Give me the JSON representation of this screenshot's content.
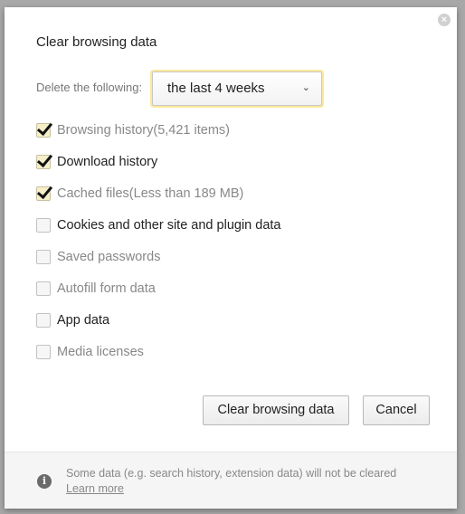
{
  "dialog": {
    "title": "Clear browsing data",
    "close_icon": "close-circle-icon",
    "delete_label": "Delete the following:",
    "time_range": "the last 4 weeks",
    "options": [
      {
        "label": "Browsing history",
        "detail": " (5,421 items)",
        "checked": true
      },
      {
        "label": "Download history",
        "detail": "",
        "checked": true
      },
      {
        "label": "Cached files",
        "detail": " (Less than 189 MB)",
        "checked": true
      },
      {
        "label": "Cookies and other site and plugin data",
        "detail": "",
        "checked": false
      },
      {
        "label": "Saved passwords",
        "detail": "",
        "checked": false
      },
      {
        "label": "Autofill form data",
        "detail": "",
        "checked": false
      },
      {
        "label": "App data",
        "detail": "",
        "checked": false
      },
      {
        "label": "Media licenses",
        "detail": "",
        "checked": false
      }
    ],
    "clear_button": "Clear browsing data",
    "cancel_button": "Cancel",
    "footer": {
      "info_icon": "info-icon",
      "text": "Some data (e.g. search history, extension data) will not be cleared",
      "link": "Learn more"
    }
  }
}
